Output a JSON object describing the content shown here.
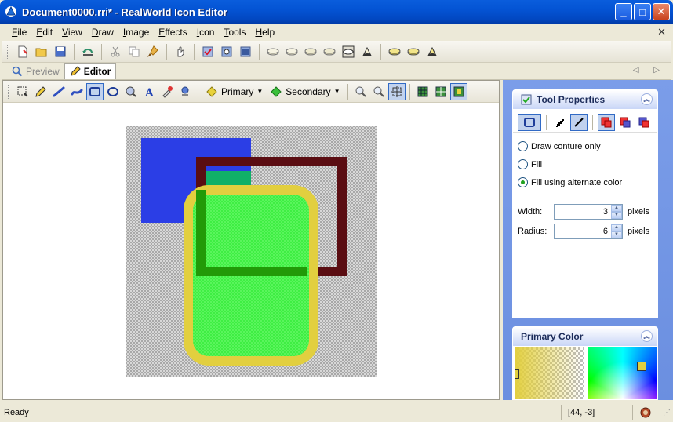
{
  "window": {
    "title": "Document0000.rri* - RealWorld Icon Editor",
    "minimize": "_",
    "maximize": "□",
    "close": "✕"
  },
  "menu": {
    "items": [
      {
        "key": "F",
        "rest": "ile"
      },
      {
        "key": "E",
        "rest": "dit"
      },
      {
        "key": "V",
        "rest": "iew"
      },
      {
        "key": "D",
        "rest": "raw"
      },
      {
        "key": "I",
        "rest": "mage"
      },
      {
        "key": "E",
        "rest": "ffects"
      },
      {
        "key": "I",
        "rest": "con"
      },
      {
        "key": "T",
        "rest": "ools"
      },
      {
        "key": "H",
        "rest": "elp"
      }
    ],
    "close_glyph": "✕"
  },
  "tabs": [
    {
      "label": "Preview",
      "active": false
    },
    {
      "label": "Editor",
      "active": true
    }
  ],
  "tab_nav": "◁ ▷",
  "editor_toolbar": {
    "primary_label": "Primary",
    "secondary_label": "Secondary"
  },
  "tool_properties": {
    "title": "Tool Properties",
    "options": [
      {
        "label": "Draw conture only",
        "checked": false
      },
      {
        "label": "Fill",
        "checked": false
      },
      {
        "label": "Fill using alternate color",
        "checked": true
      }
    ],
    "width_label": "Width:",
    "width_value": "3",
    "radius_label": "Radius:",
    "radius_value": "6",
    "unit": "pixels"
  },
  "primary_color": {
    "title": "Primary Color"
  },
  "status": {
    "text": "Ready",
    "coords": "[44, -3]"
  },
  "colors": {
    "blue_rect": "#2b3ee6",
    "dark_rect": "#5a0d12",
    "yellow_outline": "#e2cf3f",
    "green_fill": "#3fee43",
    "dark_green": "#229a08"
  }
}
